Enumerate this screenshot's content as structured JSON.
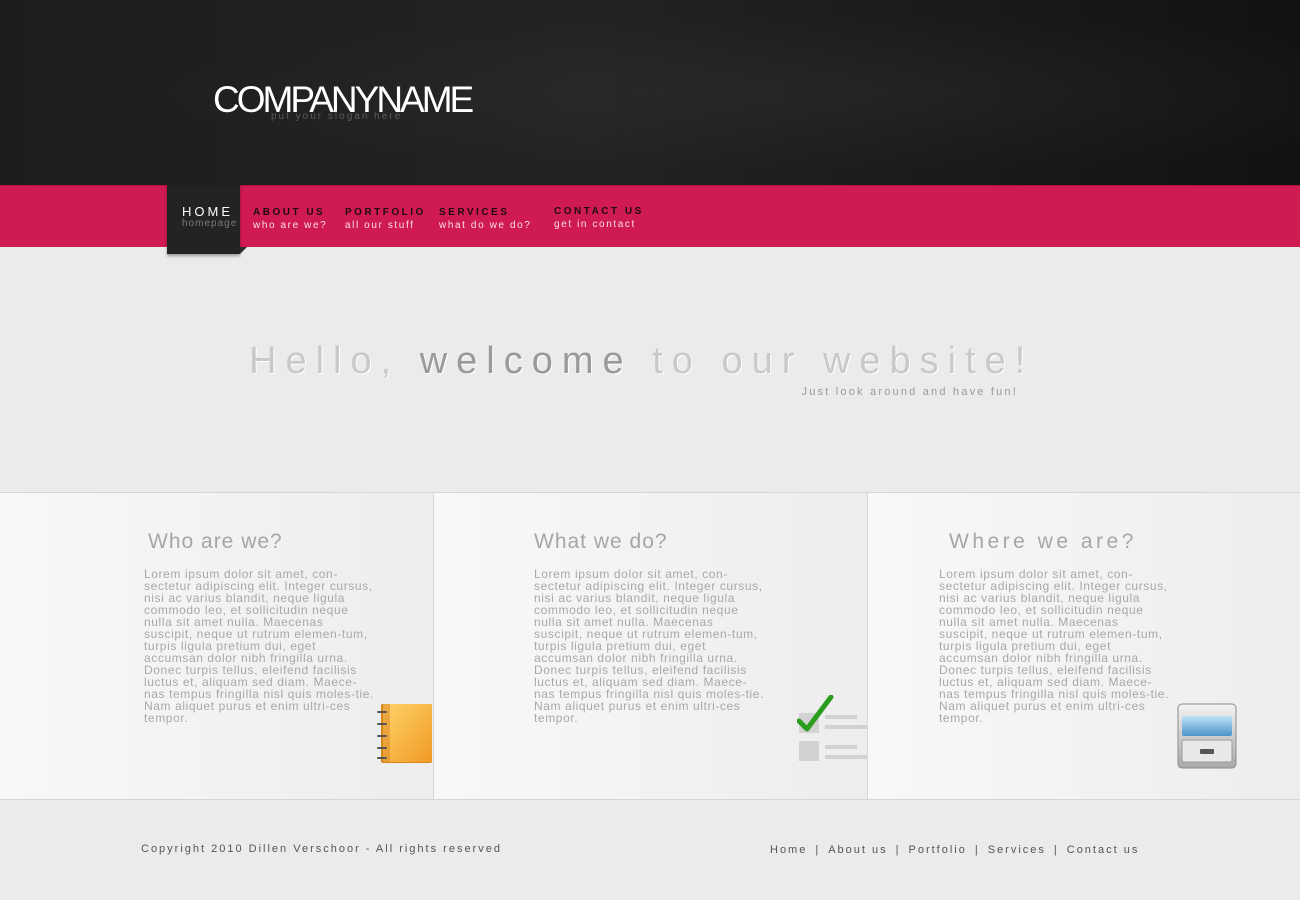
{
  "header": {
    "logo": "COMPANYNAME",
    "slogan": "put your slogan here"
  },
  "nav": {
    "items": [
      {
        "title": "HOME",
        "subtitle": "homepage",
        "active": true
      },
      {
        "title": "ABOUT US",
        "subtitle": "who are we?"
      },
      {
        "title": "PORTFOLIO",
        "subtitle": "all our stuff"
      },
      {
        "title": "SERVICES",
        "subtitle": "what do we do?"
      },
      {
        "title": "CONTACT US",
        "subtitle": "get in contact"
      }
    ]
  },
  "welcome": {
    "part1": "Hello, ",
    "highlight": "welcome",
    "part2": " to our website!",
    "subtitle": "Just look around and have fun!"
  },
  "columns": [
    {
      "heading": "Who are we?",
      "text": "Lorem ipsum dolor sit amet, con-sectetur adipiscing elit. Integer cursus, nisi ac varius blandit, neque ligula commodo leo, et sollicitudin neque nulla sit amet nulla. Maecenas suscipit, neque ut rutrum elemen-tum, turpis ligula pretium dui, eget accumsan dolor nibh fringilla urna. Donec turpis tellus, eleifend facilisis luctus et, aliquam sed diam. Maece-nas tempus fringilla nisl quis moles-tie. Nam aliquet purus et enim ultri-ces tempor.",
      "icon": "notebook-icon"
    },
    {
      "heading": "What we do?",
      "text": "Lorem ipsum dolor sit amet, con-sectetur adipiscing elit. Integer cursus, nisi ac varius blandit, neque ligula commodo leo, et sollicitudin neque nulla sit amet nulla. Maecenas suscipit, neque ut rutrum elemen-tum, turpis ligula pretium dui, eget accumsan dolor nibh fringilla urna. Donec turpis tellus, eleifend facilisis luctus et, aliquam sed diam. Maece-nas tempus fringilla nisl quis moles-tie. Nam aliquet purus et enim ultri-ces tempor.",
      "icon": "checklist-icon"
    },
    {
      "heading": "Where we are?",
      "text": "Lorem ipsum dolor sit amet, con-sectetur adipiscing elit. Integer cursus, nisi ac varius blandit, neque ligula commodo leo, et sollicitudin neque nulla sit amet nulla. Maecenas suscipit, neque ut rutrum elemen-tum, turpis ligula pretium dui, eget accumsan dolor nibh fringilla urna. Donec turpis tellus, eleifend facilisis luctus et, aliquam sed diam. Maece-nas tempus fringilla nisl quis moles-tie. Nam aliquet purus et enim ultri-ces tempor.",
      "icon": "file-cabinet-icon"
    }
  ],
  "footer": {
    "copyright": "Copyright 2010 Dillen Verschoor - All rights reserved",
    "links": [
      "Home",
      "About us",
      "Portfolio",
      "Services",
      "Contact us"
    ],
    "separator": "|"
  },
  "colors": {
    "nav_accent": "#d01a52",
    "header_bg": "#1d1d1d",
    "page_bg": "#ebebeb"
  }
}
